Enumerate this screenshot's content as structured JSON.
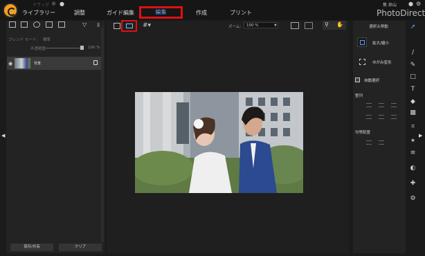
{
  "app": {
    "brand": "PhotoDirector",
    "user": "焦 井山",
    "undo_hint": "ドラッグ"
  },
  "tabs": [
    {
      "label": "ライブラリー"
    },
    {
      "label": "調整"
    },
    {
      "label": "ガイド編集"
    },
    {
      "label": "編集",
      "active": true
    },
    {
      "label": "作成"
    },
    {
      "label": "プリント"
    }
  ],
  "left_panel": {
    "blend_mode_label": "ブレンド モード:",
    "blend_mode_value": "標準",
    "opacity_label": "不透明度:",
    "opacity_value": "100 %",
    "opacity_level": 1.0,
    "layer_name": "背景",
    "save_share_label": "保存/共有",
    "clear_label": "クリア"
  },
  "canvas": {
    "zoom_label": "ズーム:",
    "zoom_value": "100 %"
  },
  "right_panel": {
    "title": "選択＆移動",
    "scale_label": "拡大/縮小",
    "warp_label": "ゆがみ変形",
    "auto_select_label": "自動選択",
    "auto_select_checked": true,
    "align_label": "整列",
    "distribute_label": "均等配置"
  },
  "tool_strip": [
    "move-select-icon",
    "pen-icon",
    "brush-icon",
    "rectangle-icon",
    "text-icon",
    "fill-icon",
    "gradient-icon",
    "crop-icon",
    "magic-wand-icon",
    "adjust-icon",
    "contrast-icon",
    "heal-icon",
    "gear-icon"
  ],
  "colors": {
    "accent": "#66aaff",
    "highlight_box": "#e01010"
  }
}
